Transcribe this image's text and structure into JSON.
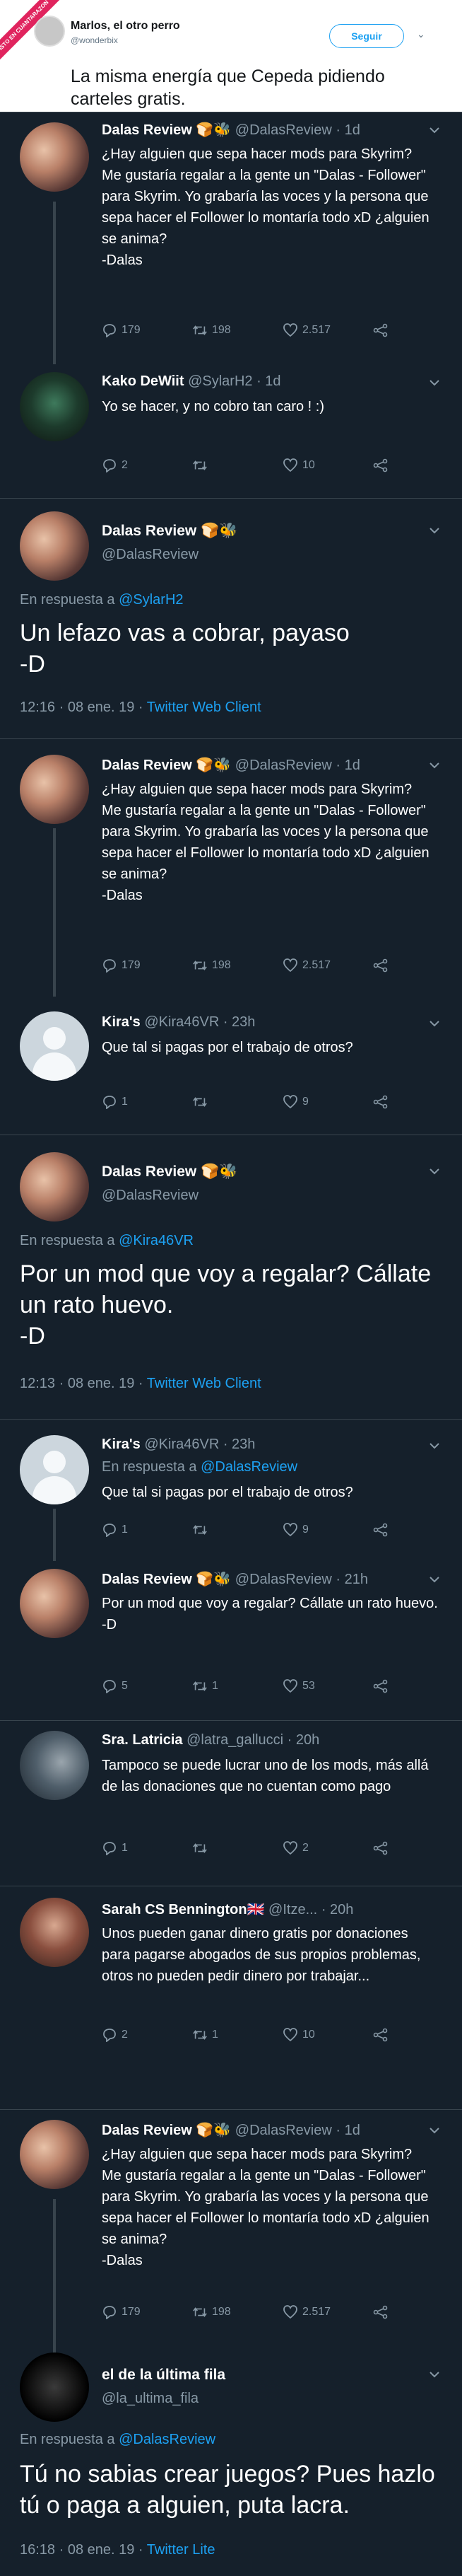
{
  "header": {
    "ribbon": "VISTO EN CUANTARAZON",
    "name": "Marlos, el otro perro",
    "handle": "@wonderbix",
    "follow": "Seguir",
    "chevron": "⌄",
    "text": "La misma energía que Cepeda pidiendo carteles gratis."
  },
  "colors": {
    "background": "#15202b",
    "accent": "#1da1f2",
    "divider": "#38444d",
    "muted": "#8899a6"
  },
  "dalas_tweet": {
    "name": "Dalas Review",
    "emoji": "🍞🐝",
    "handle": "@DalasReview",
    "time": "· 1d",
    "text": "¿Hay alguien que sepa hacer mods para Skyrim?\nMe gustaría regalar a la gente un \"Dalas - Follower\" para Skyrim. Yo grabaría las voces y la persona que sepa hacer el Follower lo montaría todo xD ¿alguien se anima?\n-Dalas",
    "replies": "179",
    "retweets": "198",
    "likes": "2.517"
  },
  "kako": {
    "name": "Kako DeWiit",
    "handle": "@SylarH2",
    "time": "· 1d",
    "text": "Yo se hacer, y no cobro tan caro ! :)",
    "replies": "2",
    "retweets": "",
    "likes": "10"
  },
  "focus1": {
    "name": "Dalas Review",
    "emoji": "🍞🐝",
    "handle": "@DalasReview",
    "reply_prefix": "En respuesta a ",
    "reply_to": "@SylarH2",
    "text": "Un lefazo vas a cobrar, payaso\n-D",
    "meta": "12:16 · 08 ene. 19 · ",
    "client": "Twitter Web Client"
  },
  "kira": {
    "name": "Kira's",
    "handle": "@Kira46VR",
    "time": "· 23h",
    "text": "Que tal si pagas por el trabajo de otros?",
    "replies": "1",
    "retweets": "",
    "likes": "9",
    "reply_prefix": "En respuesta a ",
    "reply_to": "@DalasReview"
  },
  "focus2": {
    "name": "Dalas Review",
    "emoji": "🍞🐝",
    "handle": "@DalasReview",
    "reply_prefix": "En respuesta a ",
    "reply_to": "@Kira46VR",
    "text": "Por un mod que voy a regalar? Cállate un rato huevo.\n-D",
    "meta": "12:13 · 08 ene. 19 · ",
    "client": "Twitter Web Client"
  },
  "dalas_reply": {
    "name": "Dalas Review",
    "emoji": "🍞🐝",
    "handle": "@DalasReview",
    "time": "· 21h",
    "text": "Por un mod que voy a regalar? Cállate un rato huevo.\n-D",
    "replies": "5",
    "retweets": "1",
    "likes": "53"
  },
  "latricia": {
    "name": "Sra. Latricia",
    "handle": "@latra_gallucci",
    "time": "· 20h",
    "text": "Tampoco se puede lucrar uno de los mods, más allá de las donaciones que no cuentan como pago",
    "replies": "1",
    "retweets": "",
    "likes": "2"
  },
  "sarah": {
    "name": "Sarah CS Bennington🇬🇧",
    "handle": "@Itze...",
    "time": "· 20h",
    "text": "Unos pueden ganar dinero gratis por donaciones para pagarse abogados de sus propios problemas, otros no pueden pedir dinero por trabajar...",
    "replies": "2",
    "retweets": "1",
    "likes": "10"
  },
  "focus3": {
    "name": "el de la última fila",
    "handle": "@la_ultima_fila",
    "reply_prefix": "En respuesta a ",
    "reply_to": "@DalasReview",
    "text": "Tú no sabias crear juegos? Pues hazlo tú o paga a alguien, puta lacra.",
    "meta": "16:18 · 08 ene. 19 · ",
    "client": "Twitter Lite"
  },
  "icons": {
    "reply": "reply-icon",
    "retweet": "retweet-icon",
    "like": "heart-icon",
    "share": "share-icon",
    "chevron": "chevron-down-icon"
  }
}
